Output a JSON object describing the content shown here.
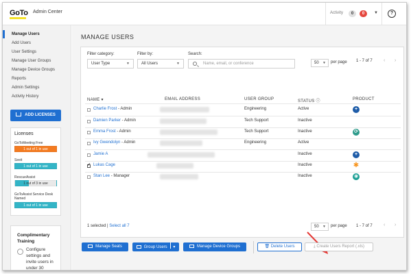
{
  "header": {
    "logo": "GoTo",
    "app_title": "Admin Center",
    "activity_label": "Activity",
    "activity_count_gray": "0",
    "activity_count_red": "0",
    "help_label": "?"
  },
  "sidebar": {
    "items": [
      {
        "label": "Manage Users",
        "active": true
      },
      {
        "label": "Add Users"
      },
      {
        "label": "User Settings"
      },
      {
        "label": "Manage User Groups"
      },
      {
        "label": "Manage Device Groups"
      },
      {
        "label": "Reports"
      },
      {
        "label": "Admin Settings"
      },
      {
        "label": "Activity History"
      }
    ],
    "add_licenses_label": "ADD LICENSES",
    "licenses": {
      "title": "Licenses",
      "products": [
        {
          "name": "GoToMeeting Free",
          "usage": "1 out of 1 in use",
          "color": "#f47b20"
        },
        {
          "name": "Seeit",
          "usage": "1 out of 1 in use",
          "color": "#33b5c7"
        },
        {
          "name": "RescueAssist",
          "usage": "1 out of 3 in use",
          "color": "#33b5c7",
          "fill": 0.33
        },
        {
          "name": "GoToAssist Service Desk Named",
          "usage": "1 out of 1 in use",
          "color": "#33b5c7"
        }
      ]
    },
    "complimentary": {
      "title": "Complimentary Training",
      "text": "Configure settings and invite users in under 30"
    }
  },
  "main": {
    "title": "MANAGE USERS",
    "filters": {
      "category_label": "Filter category:",
      "category_value": "User Type",
      "filterby_label": "Filter by:",
      "filterby_value": "All Users",
      "search_label": "Search:",
      "search_placeholder": "Name, email, or conference"
    },
    "pagination": {
      "per_page_value": "50",
      "per_page_label": "per page",
      "range": "1 - 7 of 7",
      "prev": "‹",
      "next": "›"
    },
    "columns": [
      "NAME ▾",
      "EMAIL ADDRESS",
      "USER GROUP",
      "STATUS ⓘ",
      "PRODUCT"
    ],
    "rows": [
      {
        "name": "Charlie Frost",
        "role": " - Admin",
        "group": "Engineering",
        "status": "Active",
        "product_icon": "plus-circle-icon",
        "product_color": "#1e5ca8",
        "product_glyph": "+",
        "checked": false
      },
      {
        "name": "Damien Parker",
        "role": " - Admin",
        "group": "Tech Support",
        "status": "Inactive",
        "product_icon": "none",
        "product_color": "",
        "product_glyph": "",
        "checked": false
      },
      {
        "name": "Emma Frost",
        "role": " - Admin",
        "group": "Tech Support",
        "status": "Inactive",
        "product_icon": "rescueassist-icon",
        "product_color": "#2c9a8a",
        "product_glyph": "⟳",
        "checked": false
      },
      {
        "name": "Ivy Gwendolyn",
        "role": " - Admin",
        "group": "Engineering",
        "status": "Active",
        "product_icon": "none",
        "product_color": "",
        "product_glyph": "",
        "checked": false
      },
      {
        "name": "Jamie A",
        "role": "",
        "group": "",
        "status": "Inactive",
        "product_icon": "plus-circle-icon",
        "product_color": "#1e5ca8",
        "product_glyph": "+",
        "checked": false
      },
      {
        "name": "Lukas Cage",
        "role": "",
        "group": "",
        "status": "Inactive",
        "product_icon": "asterisk-icon",
        "product_color": "#f7941d",
        "product_glyph": "✱",
        "checked": true
      },
      {
        "name": "Stan Lee",
        "role": " - Manager",
        "group": "",
        "status": "Inactive",
        "product_icon": "seeit-icon",
        "product_color": "#1a9e93",
        "product_glyph": "◉",
        "checked": false
      }
    ],
    "selection": {
      "selected_text": "1 selected",
      "separator": " | ",
      "select_all": "Select all 7"
    },
    "buttons": {
      "manage_seats": "Manage Seats",
      "group_users": "Group Users",
      "group_users_caret": "▾",
      "manage_device_groups": "Manage Device Groups",
      "delete_users": "Delete Users",
      "create_report": "Create Users Report (.xls)"
    }
  }
}
